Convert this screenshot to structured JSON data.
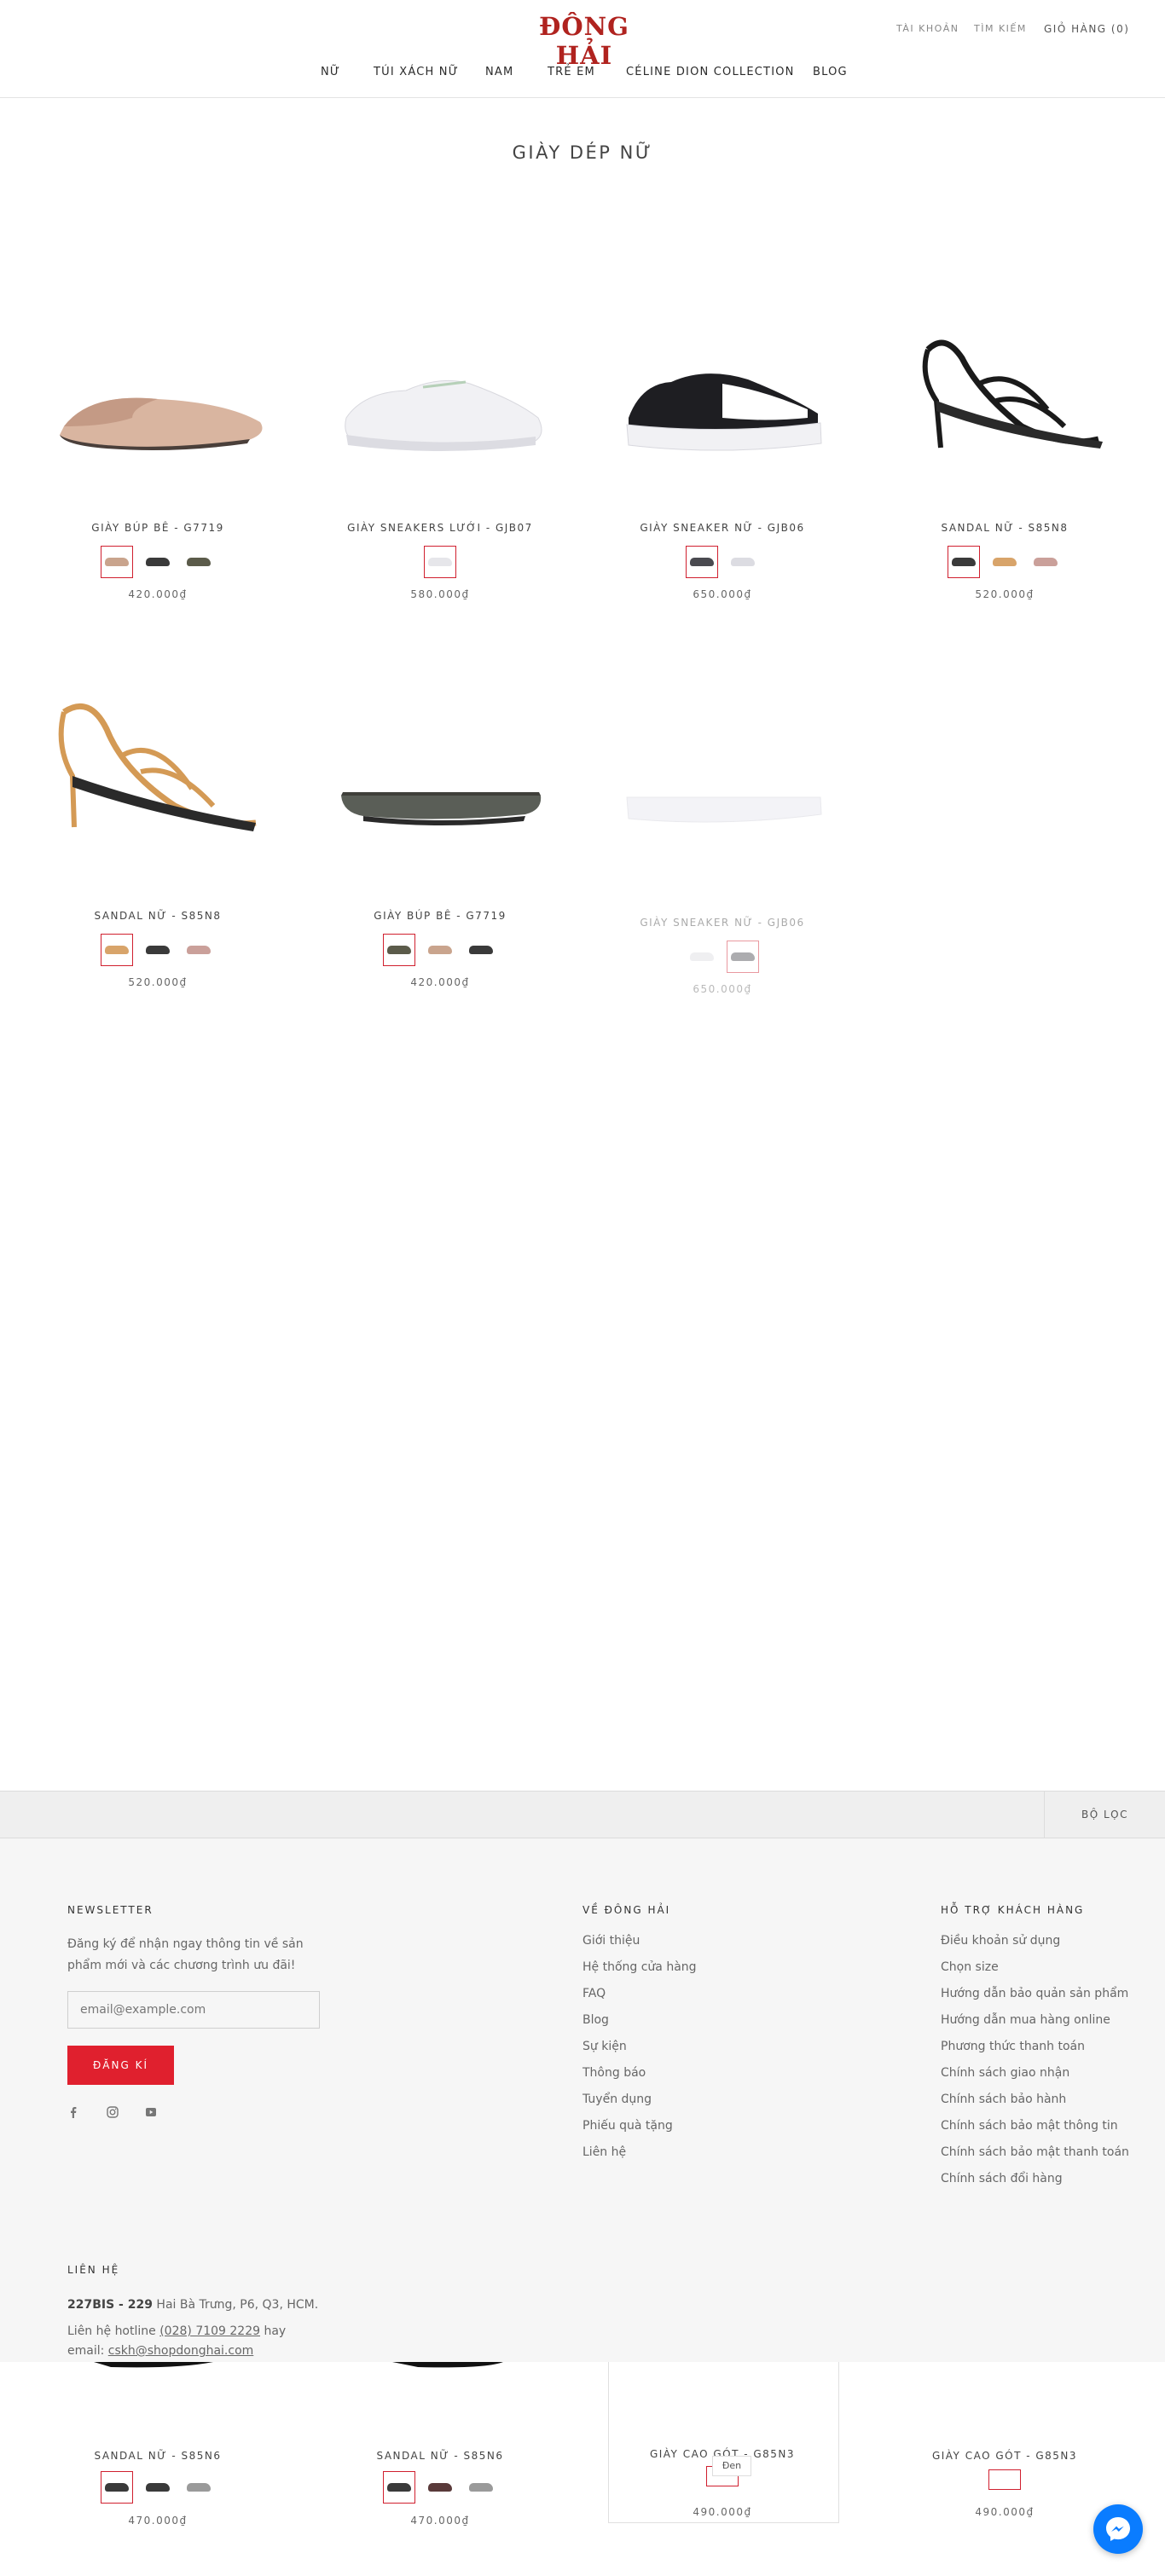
{
  "header": {
    "logo_text": "ĐÔNG HẢI",
    "account": "TÀI KHOẢN",
    "search": "TÌM KIẾM",
    "cart": "GIỎ HÀNG (0)"
  },
  "nav": {
    "items": [
      "NỮ",
      "TÚI XÁCH NỮ",
      "NAM",
      "TRẺ EM",
      "CÉLINE DION COLLECTION",
      "BLOG"
    ]
  },
  "collection": {
    "title": "GIÀY DÉP NỮ"
  },
  "products": [
    {
      "name": "GIÀY BÚP BÊ - G7719",
      "price": "420.000₫",
      "swatches": [
        "#c9a48d",
        "#3a3a3a",
        "#5b5b4a"
      ],
      "active": 0,
      "icon": "flat-shoe-icon"
    },
    {
      "name": "GIÀY SNEAKERS LƯỚI - GJB07",
      "price": "580.000₫",
      "swatches": [
        "#e6e6ea"
      ],
      "active": 0,
      "icon": "sneaker-icon"
    },
    {
      "name": "GIÀY SNEAKER NỮ - GJB06",
      "price": "650.000₫",
      "swatches": [
        "#4a4a50",
        "#dcdce2"
      ],
      "active": 0,
      "icon": "sneaker-icon"
    },
    {
      "name": "SANDAL NỮ - S85N8",
      "price": "520.000₫",
      "swatches": [
        "#3a3a3a",
        "#d8a46a",
        "#caa09a"
      ],
      "active": 0,
      "icon": "sandal-icon"
    },
    {
      "name": "SANDAL NỮ - S85N8",
      "price": "520.000₫",
      "swatches": [
        "#d8a46a",
        "#3a3a3a",
        "#caa09a"
      ],
      "active": 0,
      "icon": "sandal-icon"
    },
    {
      "name": "GIÀY BÚP BÊ - G7719",
      "price": "420.000₫",
      "swatches": [
        "#5b5b4a",
        "#c9a48d",
        "#3a3a3a"
      ],
      "active": 0,
      "icon": "flat-shoe-icon"
    },
    {
      "name": "GIÀY SNEAKER NỮ - GJB06",
      "price": "650.000₫",
      "swatches": [
        "#dcdce2",
        "#4a4a50"
      ],
      "active": 1,
      "icon": "sneaker-icon"
    }
  ],
  "filter": {
    "label": "BỘ LỌC"
  },
  "footer": {
    "newsletter_title": "NEWSLETTER",
    "newsletter_text": "Đăng ký để nhận ngay thông tin về sản phẩm mới và các chương trình ưu đãi!",
    "email_placeholder": "email@example.com",
    "subscribe_label": "ĐĂNG KÍ",
    "about_title": "VỀ ĐÔNG HẢI",
    "about_links": [
      "Giới thiệu",
      "Hệ thống cửa hàng",
      "FAQ",
      "Blog",
      "Sự kiện",
      "Thông báo",
      "Tuyển dụng",
      "Phiếu quà tặng",
      "Liên hệ"
    ],
    "support_title": "HỖ TRỢ KHÁCH HÀNG",
    "support_links": [
      "Điều khoản sử dụng",
      "Chọn size",
      "Hướng dẫn bảo quản sản phẩm",
      "Hướng dẫn mua hàng online",
      "Phương thức thanh toán",
      "Chính sách giao nhận",
      "Chính sách bảo hành",
      "Chính sách bảo mật thông tin",
      "Chính sách bảo mật thanh toán",
      "Chính sách đổi hàng"
    ],
    "contact_title": "LIÊN HỆ",
    "address_bold": "227BIS - 229",
    "address_rest": " Hai Bà Trưng, P6, Q3, HCM.",
    "hotline_prefix": "Liên hệ hotline ",
    "hotline": "(028) 7109 2229",
    "hotline_suffix": " hay",
    "email_prefix": "email: ",
    "email": "cskh@shopdonghai.com"
  },
  "bottom_products": [
    {
      "name": "SANDAL NỮ - S85N6",
      "price": "470.000₫",
      "swatches": [
        "#3a3a3a",
        "#3a3a3a",
        "#9a9a9a"
      ],
      "active": 0
    },
    {
      "name": "SANDAL NỮ - S85N6",
      "price": "470.000₫",
      "swatches": [
        "#3a3a3a",
        "#5a3a3a",
        "#9a9a9a"
      ],
      "active": 0
    },
    {
      "name": "GIÀY CAO GÓT - G85N3",
      "price": "490.000₫",
      "swatches": [
        "#ffffff"
      ],
      "active": 0
    },
    {
      "name": "GIÀY CAO GÓT - G85N3",
      "price": "490.000₫",
      "swatches": [
        "#ffffff"
      ],
      "active": 0
    }
  ],
  "tooltip": {
    "label": "Đen"
  }
}
